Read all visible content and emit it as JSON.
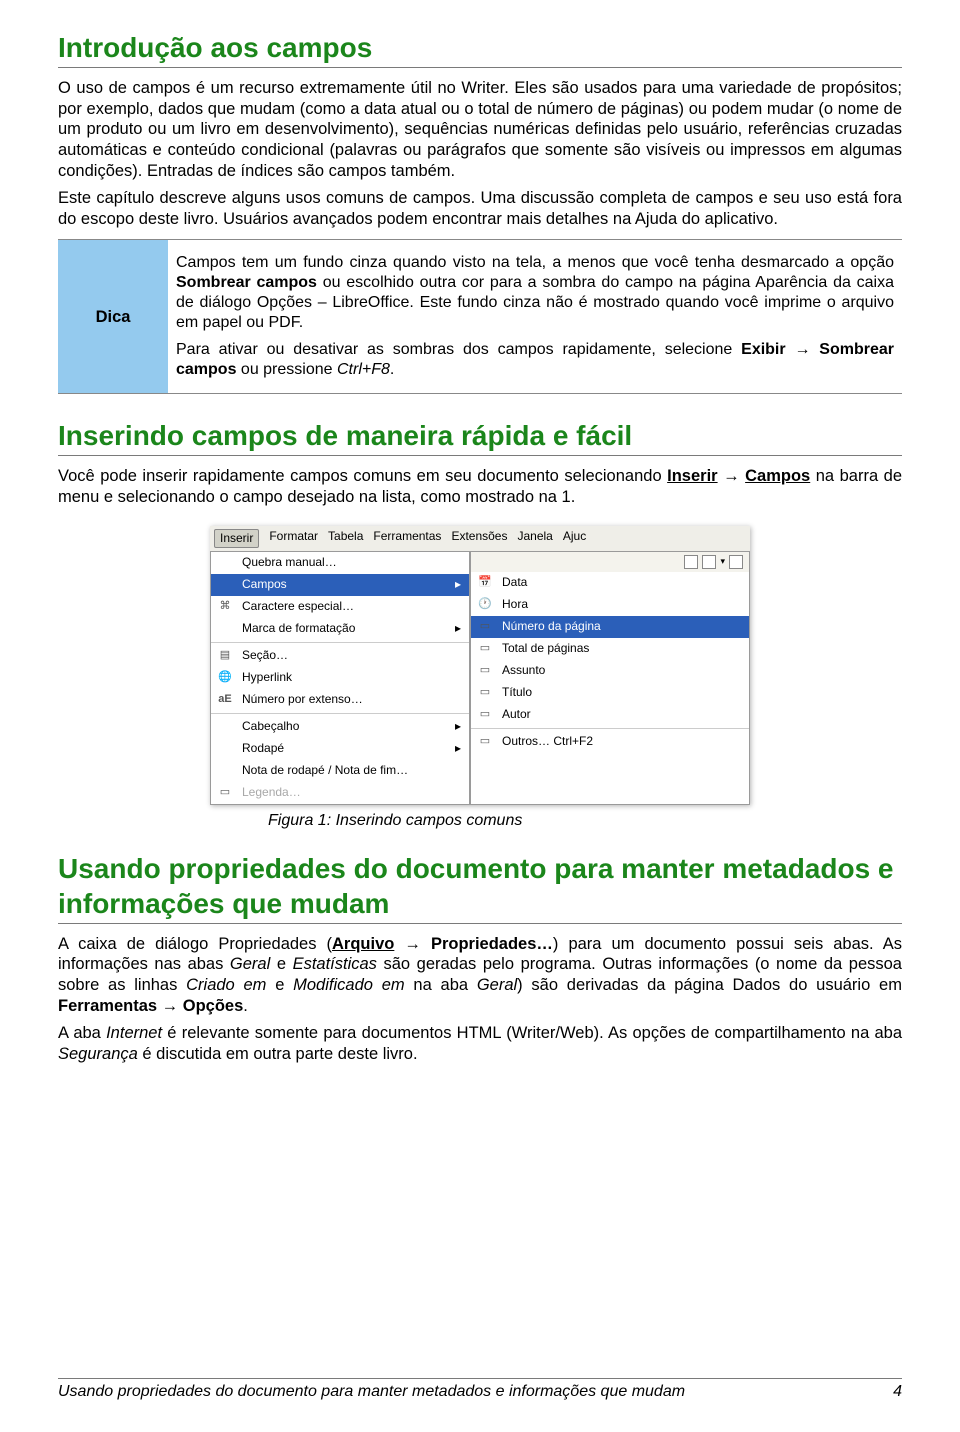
{
  "h1_intro": "Introdução aos campos",
  "p_intro1": "O uso de campos é um recurso extremamente útil no Writer. Eles são usados para uma variedade de propósitos; por exemplo, dados que mudam (como a data atual ou o total de número de páginas) ou podem mudar (o nome de um produto ou um livro em desenvolvimento), sequências numéricas definidas pelo usuário, referências cruzadas automáticas e conteúdo condicional (palavras ou parágrafos que somente são visíveis ou impressos em algumas condições). Entradas de índices são campos também.",
  "p_intro2": "Este capítulo descreve alguns usos comuns de campos. Uma discussão completa de campos e seu uso está fora do escopo deste livro. Usuários avançados podem encontrar mais detalhes na Ajuda do aplicativo.",
  "tip_label": "Dica",
  "tip_body1a": "Campos tem um fundo cinza quando visto na tela, a menos que você tenha desmarcado a opção ",
  "tip_body1b": "Sombrear campos",
  "tip_body1c": " ou escolhido outra cor para a sombra do campo na página Aparência da caixa de diálogo Opções – LibreOffice. Este fundo cinza não é mostrado quando você imprime o arquivo em papel ou PDF.",
  "tip_body2a": "Para ativar ou desativar as sombras dos campos rapidamente, selecione ",
  "tip_body2b": "Exibir",
  "tip_body2c": " → ",
  "tip_body2d": "Sombrear campos",
  "tip_body2e": " ou pressione ",
  "tip_body2f": "Ctrl+F8",
  "tip_body2g": ".",
  "h1_insert": "Inserindo campos de maneira rápida e fácil",
  "p_insert_a": "Você pode inserir rapidamente campos comuns em seu documento selecionando ",
  "p_insert_b": "Inserir",
  "p_insert_c": " → ",
  "p_insert_d": "Campos",
  "p_insert_e": " na barra de menu e selecionando o campo desejado na lista, como mostrado na 1.",
  "menubar": {
    "inserir": "Inserir",
    "formatar": "Formatar",
    "tabela": "Tabela",
    "ferramentas": "Ferramentas",
    "extensoes": "Extensões",
    "janela": "Janela",
    "ajuda": "Ajuc"
  },
  "menu_left": {
    "quebra": "Quebra manual…",
    "campos": "Campos",
    "caractere": "Caractere especial…",
    "marca": "Marca de formatação",
    "secao": "Seção…",
    "hyperlink": "Hyperlink",
    "numero": "Número por extenso…",
    "cabecalho": "Cabeçalho",
    "rodape": "Rodapé",
    "nota": "Nota de rodapé / Nota de fim…",
    "legenda": "Legenda…"
  },
  "menu_right": {
    "data": "Data",
    "hora": "Hora",
    "numpag": "Número da página",
    "totpag": "Total de páginas",
    "assunto": "Assunto",
    "titulo": "Título",
    "autor": "Autor",
    "outros": "Outros…   Ctrl+F2"
  },
  "caption": "Figura 1: Inserindo campos comuns",
  "h1_props": "Usando propriedades do documento para manter metadados e informações que mudam",
  "p_props1a": "A caixa de diálogo Propriedades (",
  "p_props1b": "Arquivo",
  "p_props1c": " → ",
  "p_props1d": "Propriedades…",
  "p_props1e": ") para um documento possui seis abas. As informações nas abas ",
  "p_props1f": "Geral",
  "p_props1g": " e ",
  "p_props1h": "Estatísticas",
  "p_props1i": " são geradas pelo programa. Outras informações (o nome da pessoa sobre as linhas ",
  "p_props1j": "Criado em",
  "p_props1k": " e ",
  "p_props1l": "Modificado em",
  "p_props1m": " na aba ",
  "p_props1n": "Geral",
  "p_props1o": ") são derivadas da página Dados do usuário em ",
  "p_props1p": "Ferramentas",
  "p_props1q": " → ",
  "p_props1r": "Opções",
  "p_props1s": ".",
  "p_props2a": "A aba ",
  "p_props2b": "Internet",
  "p_props2c": " é relevante somente para documentos HTML (Writer/Web). As opções de compartilhamento na aba ",
  "p_props2d": "Segurança",
  "p_props2e": " é discutida em outra parte deste livro.",
  "footer_text": "Usando propriedades do documento para manter metadados e informações que mudam",
  "footer_page": "4"
}
